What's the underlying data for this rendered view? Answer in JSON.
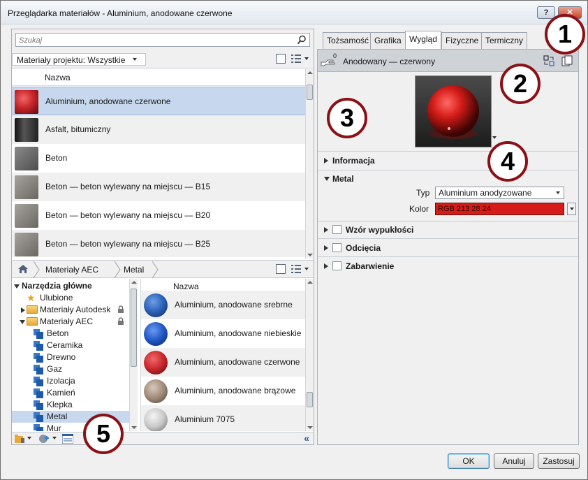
{
  "window": {
    "title": "Przeglądarka materiałów - Aluminium, anodowane czerwone",
    "help_label": "?",
    "close_label": "✕"
  },
  "search": {
    "placeholder": "Szukaj"
  },
  "project_filter": {
    "label": "Materiały projektu: Wszystkie"
  },
  "project_list": {
    "column_header": "Nazwa",
    "rows": [
      {
        "name": "Aluminium, anodowane czerwone",
        "swatch": "#c8262a",
        "selected": true
      },
      {
        "name": "Asfalt, bitumiczny",
        "swatch": "#2c2c2c"
      },
      {
        "name": "Beton",
        "swatch": "#6f6f6f"
      },
      {
        "name": "Beton — beton wylewany na miejscu — B15",
        "swatch": "#8d8a86"
      },
      {
        "name": "Beton — beton wylewany na miejscu — B20",
        "swatch": "#8d8a86"
      },
      {
        "name": "Beton — beton wylewany na miejscu — B25",
        "swatch": "#8d8a86"
      }
    ]
  },
  "library_nav": {
    "crumbs": [
      "Materiały AEC",
      "Metal"
    ]
  },
  "tree": {
    "root": "Narzędzia główne",
    "favorites": "Ulubione",
    "autodesk": "Materiały Autodesk",
    "aec": "Materiały AEC",
    "children": [
      "Beton",
      "Ceramika",
      "Drewno",
      "Gaz",
      "Izolacja",
      "Kamień",
      "Klepka",
      "Metal",
      "Mur"
    ],
    "selected": "Metal"
  },
  "library_list": {
    "column_header": "Nazwa",
    "rows": [
      {
        "name": "Aluminium, anodowane srebrne",
        "swatch": "#2a5fb5"
      },
      {
        "name": "Aluminium, anodowane niebieskie",
        "swatch": "#1f56c4"
      },
      {
        "name": "Aluminium, anodowane czerwone",
        "swatch": "#c8262a"
      },
      {
        "name": "Aluminium, anodowane brązowe",
        "swatch": "#a08a78"
      },
      {
        "name": "Aluminium 7075",
        "swatch": "#c9c9c9"
      }
    ]
  },
  "tabs": [
    "Tożsamość",
    "Grafika",
    "Wygląd",
    "Fizyczne",
    "Termiczny"
  ],
  "active_tab": "Wygląd",
  "asset": {
    "count": "0",
    "name": "Anodowany — czerwony"
  },
  "sections": {
    "info": "Informacja",
    "metal": "Metal",
    "bump": "Wzór wypukłości",
    "cutouts": "Odcięcia",
    "tint": "Zabarwienie"
  },
  "metal": {
    "type_label": "Typ",
    "type_value": "Aluminium anodyzowane",
    "color_label": "Kolor",
    "color_value": "RGB 213 28 24",
    "color_hex": "#d51c18"
  },
  "buttons": {
    "ok": "OK",
    "cancel": "Anuluj",
    "apply": "Zastosuj"
  },
  "callouts": [
    "1",
    "2",
    "3",
    "4",
    "5"
  ]
}
